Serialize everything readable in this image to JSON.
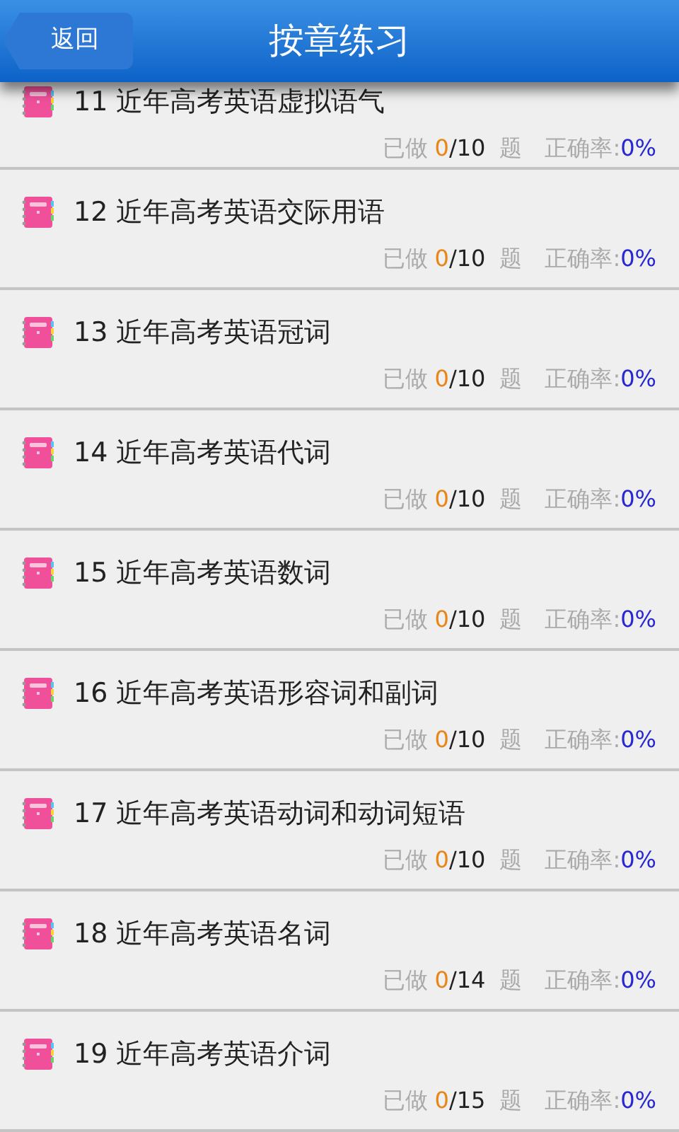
{
  "header": {
    "back_button": "返回",
    "title": "按章练习"
  },
  "chapters": [
    {
      "title": "11 近年高考英语虚拟语气",
      "done_label": "已做",
      "done": "0",
      "total": "/10",
      "unit": "题",
      "accuracy_label": "正确率:",
      "accuracy": "0%"
    },
    {
      "title": "12 近年高考英语交际用语",
      "done_label": "已做",
      "done": "0",
      "total": "/10",
      "unit": "题",
      "accuracy_label": "正确率:",
      "accuracy": "0%"
    },
    {
      "title": "13 近年高考英语冠词",
      "done_label": "已做",
      "done": "0",
      "total": "/10",
      "unit": "题",
      "accuracy_label": "正确率:",
      "accuracy": "0%"
    },
    {
      "title": "14 近年高考英语代词",
      "done_label": "已做",
      "done": "0",
      "total": "/10",
      "unit": "题",
      "accuracy_label": "正确率:",
      "accuracy": "0%"
    },
    {
      "title": "15 近年高考英语数词",
      "done_label": "已做",
      "done": "0",
      "total": "/10",
      "unit": "题",
      "accuracy_label": "正确率:",
      "accuracy": "0%"
    },
    {
      "title": "16 近年高考英语形容词和副词",
      "done_label": "已做",
      "done": "0",
      "total": "/10",
      "unit": "题",
      "accuracy_label": "正确率:",
      "accuracy": "0%"
    },
    {
      "title": "17 近年高考英语动词和动词短语",
      "done_label": "已做",
      "done": "0",
      "total": "/10",
      "unit": "题",
      "accuracy_label": "正确率:",
      "accuracy": "0%"
    },
    {
      "title": "18 近年高考英语名词",
      "done_label": "已做",
      "done": "0",
      "total": "/14",
      "unit": "题",
      "accuracy_label": "正确率:",
      "accuracy": "0%"
    },
    {
      "title": "19 近年高考英语介词",
      "done_label": "已做",
      "done": "0",
      "total": "/15",
      "unit": "题",
      "accuracy_label": "正确率:",
      "accuracy": "0%"
    }
  ]
}
